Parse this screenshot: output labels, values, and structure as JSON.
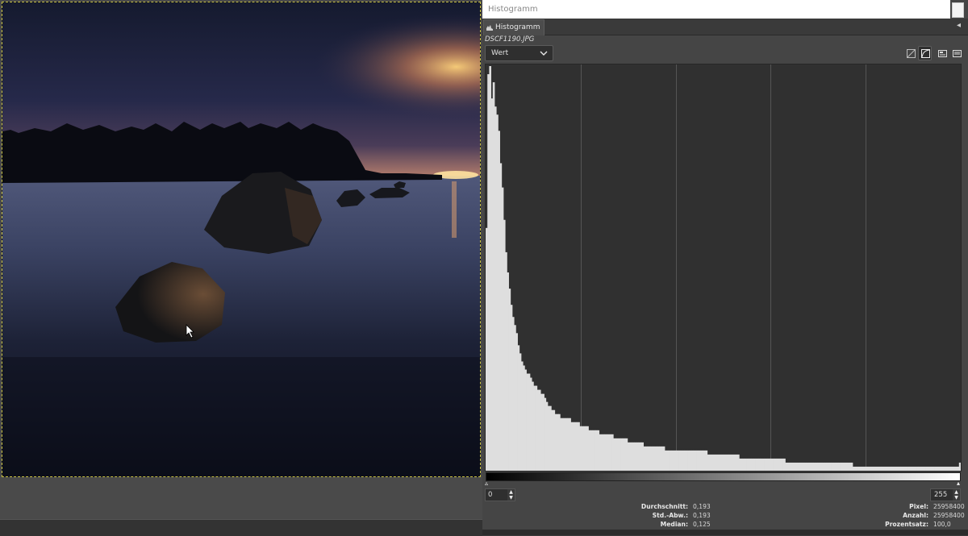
{
  "panel": {
    "window_title": "Histogramm",
    "tab_label": "Histogramm",
    "filename": "DSCF1190.JPG",
    "channel": "Wert"
  },
  "range": {
    "min": "0",
    "max": "255"
  },
  "stats": {
    "left": [
      {
        "label": "Durchschnitt:",
        "value": "0,193"
      },
      {
        "label": "Std.-Abw.:",
        "value": "0,193"
      },
      {
        "label": "Median:",
        "value": "0,125"
      }
    ],
    "right": [
      {
        "label": "Pixel:",
        "value": "25958400"
      },
      {
        "label": "Anzahl:",
        "value": "25958400"
      },
      {
        "label": "Prozentsatz:",
        "value": "100,0"
      }
    ]
  },
  "icons": {
    "tab": "histogram-icon",
    "channel_dropdown": "chevron-down-icon",
    "scale_buttons": [
      "linear-scale-icon",
      "logarithmic-scale-icon",
      "panel-layout-icon",
      "panel-menu-icon"
    ],
    "cursor": "mouse-pointer-icon"
  },
  "colors": {
    "histogram_fill": "#dedede",
    "histogram_background": "#303030",
    "selection_outline": "#c8c040"
  },
  "chart_data": {
    "type": "area",
    "series": [
      {
        "values": [
          60,
          98,
          100,
          92,
          96,
          90,
          88,
          84,
          76,
          70,
          62,
          54,
          49,
          45,
          41,
          38,
          36,
          34,
          31,
          29,
          27,
          26,
          25,
          24,
          24,
          23,
          22,
          21,
          21,
          20,
          20,
          19,
          19,
          18,
          17,
          16,
          16,
          15,
          15,
          14,
          14,
          14,
          13,
          13,
          13,
          13,
          13,
          13,
          12,
          12,
          12,
          12,
          12,
          11,
          11,
          11,
          11,
          11,
          10,
          10,
          10,
          10,
          10,
          10,
          9,
          9,
          9,
          9,
          9,
          9,
          9,
          9,
          8,
          8,
          8,
          8,
          8,
          8,
          8,
          8,
          7,
          7,
          7,
          7,
          7,
          7,
          7,
          7,
          7,
          6,
          6,
          6,
          6,
          6,
          6,
          6,
          6,
          6,
          6,
          6,
          6,
          5,
          5,
          5,
          5,
          5,
          5,
          5,
          5,
          5,
          5,
          5,
          5,
          5,
          5,
          5,
          5,
          5,
          5,
          5,
          5,
          5,
          5,
          5,
          5,
          4,
          4,
          4,
          4,
          4,
          4,
          4,
          4,
          4,
          4,
          4,
          4,
          4,
          4,
          4,
          4,
          4,
          4,
          3,
          3,
          3,
          3,
          3,
          3,
          3,
          3,
          3,
          3,
          3,
          3,
          3,
          3,
          3,
          3,
          3,
          3,
          3,
          3,
          3,
          3,
          3,
          3,
          3,
          3,
          2,
          2,
          2,
          2,
          2,
          2,
          2,
          2,
          2,
          2,
          2,
          2,
          2,
          2,
          2,
          2,
          2,
          2,
          2,
          2,
          2,
          2,
          2,
          2,
          2,
          2,
          2,
          2,
          2,
          2,
          2,
          2,
          2,
          2,
          2,
          2,
          2,
          2,
          1,
          1,
          1,
          1,
          1,
          1,
          1,
          1,
          1,
          1,
          1,
          1,
          1,
          1,
          1,
          1,
          1,
          1,
          1,
          1,
          1,
          1,
          1,
          1,
          1,
          1,
          1,
          1,
          1,
          1,
          1,
          1,
          1,
          1,
          1,
          1,
          1,
          1,
          1,
          1,
          1,
          1,
          1,
          1,
          1,
          1,
          1,
          1,
          1,
          1,
          1,
          1,
          1,
          1,
          1,
          1,
          1,
          1,
          1,
          1,
          2
        ]
      }
    ],
    "xlim": [
      0,
      255
    ],
    "ylim": [
      0,
      100
    ],
    "grid": true
  }
}
